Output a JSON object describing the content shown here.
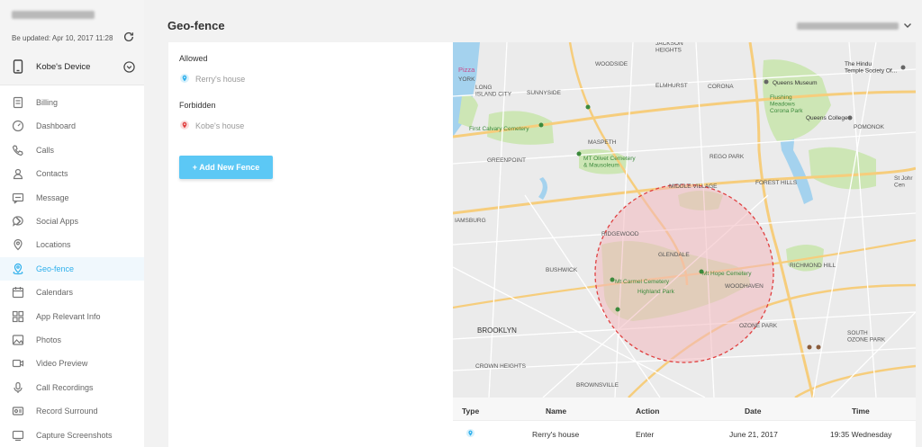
{
  "account": {
    "updated": "Be updated: Apr 10, 2017 11:28"
  },
  "device": {
    "name": "Kobe's Device"
  },
  "nav": [
    {
      "label": "Billing",
      "icon": "billing-icon"
    },
    {
      "label": "Dashboard",
      "icon": "dashboard-icon"
    },
    {
      "label": "Calls",
      "icon": "phone-icon"
    },
    {
      "label": "Contacts",
      "icon": "contacts-icon"
    },
    {
      "label": "Message",
      "icon": "message-icon"
    },
    {
      "label": "Social Apps",
      "icon": "chat-bubble-icon"
    },
    {
      "label": "Locations",
      "icon": "location-pin-icon"
    },
    {
      "label": "Geo-fence",
      "icon": "geo-fence-icon",
      "active": true
    },
    {
      "label": "Calendars",
      "icon": "calendar-icon"
    },
    {
      "label": "App Relevant Info",
      "icon": "apps-grid-icon"
    },
    {
      "label": "Photos",
      "icon": "photo-icon"
    },
    {
      "label": "Video Preview",
      "icon": "video-icon"
    },
    {
      "label": "Call Recordings",
      "icon": "microphone-icon"
    },
    {
      "label": "Record Surround",
      "icon": "recorder-icon"
    },
    {
      "label": "Capture Screenshots",
      "icon": "screenshot-icon"
    }
  ],
  "header": {
    "title": "Geo-fence"
  },
  "fences": {
    "allowed_title": "Allowed",
    "allowed": [
      "Rerry's house"
    ],
    "forbidden_title": "Forbidden",
    "forbidden": [
      "Kobe's house"
    ],
    "add_label": "+ Add New Fence"
  },
  "map_labels": {
    "pizza": "Pizza",
    "york": "YORK",
    "long_island": "LONG\nISLAND CITY",
    "sunnyside": "SUNNYSIDE",
    "woodside": "WOODSIDE",
    "jackson": "JACKSON\nHEIGHTS",
    "corona": "CORONA",
    "elmhurst": "ELMHURST",
    "queens_museum": "Queens Museum",
    "flushing": "Flushing\nMeadows\nCorona Park",
    "queens_college": "Queens College",
    "hindu": "The Hindu\nTemple Society Of...",
    "pomonok": "POMONOK",
    "first_calvary": "First Calvary Cemetery",
    "maspeth": "MASPETH",
    "greenpoint": "GREENPOINT",
    "olivet": "MT Olivet Cemetery\n& Mausoleum",
    "rego": "REGO PARK",
    "middle_village": "MIDDLE VILLAGE",
    "forest_hills": "FOREST HILLS",
    "williamsburg": "IAMSBURG",
    "ridgewood": "RIDGEWOOD",
    "glendale": "GLENDALE",
    "mt_hope": "Mt Hope Cemetery",
    "mt_carmel": "Mt Carmel Cemetery",
    "highland": "Highland Park",
    "bushwick": "BUSHWICK",
    "woodhaven": "WOODHAVEN",
    "richmond_hill": "RICHMOND HILL",
    "brooklyn": "BROOKLYN",
    "crown_heights": "CROWN HEIGHTS",
    "brownsville": "BROWNSVILLE",
    "ozone_park": "OZONE PARK",
    "south_ozone": "SOUTH\nOZONE PARK",
    "st_john": "St Johr\nCen"
  },
  "table": {
    "headers": {
      "type": "Type",
      "name": "Name",
      "action": "Action",
      "date": "Date",
      "time": "Time"
    },
    "rows": [
      {
        "type_icon": "allowed-pin-icon",
        "name": "Rerry's house",
        "action": "Enter",
        "date": "June 21, 2017",
        "time": "19:35 Wednesday"
      }
    ]
  },
  "colors": {
    "accent": "#2fb0ec",
    "button": "#5cc8f5",
    "forbidden": "#e04040",
    "fence_fill": "#f2b8bd"
  }
}
